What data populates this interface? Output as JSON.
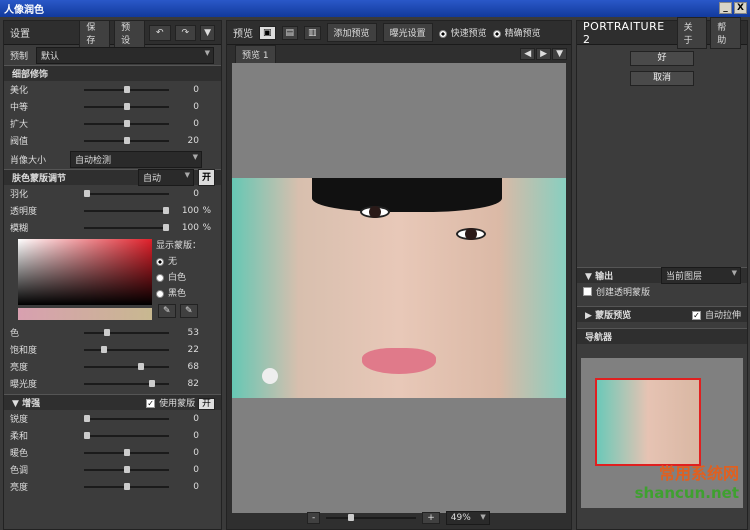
{
  "window": {
    "title": "人像润色",
    "min": "_",
    "close": "X"
  },
  "left": {
    "header": {
      "title": "设置",
      "save": "保存",
      "preset": "预设"
    },
    "preset": {
      "label": "预制",
      "value": "默认"
    },
    "detail": {
      "title": "细部修饰",
      "rows": [
        {
          "label": "美化",
          "value": "0",
          "level": 0.5
        },
        {
          "label": "中等",
          "value": "0",
          "level": 0.5
        },
        {
          "label": "扩大",
          "value": "0",
          "level": 0.5
        },
        {
          "label": "阀值",
          "value": "20",
          "level": 0.5
        }
      ],
      "size_label": "肖像大小",
      "size_value": "自动检测"
    },
    "mask": {
      "title": "肤色蒙版调节",
      "mode": "自动",
      "on": "开",
      "rows": [
        {
          "label": "羽化",
          "value": "0",
          "unit": "",
          "level": 0.0
        },
        {
          "label": "透明度",
          "value": "100",
          "unit": "%",
          "level": 1.0
        },
        {
          "label": "模糊",
          "value": "100",
          "unit": "%",
          "level": 1.0
        }
      ],
      "show_label": "显示蒙版：",
      "options": [
        "无",
        "白色",
        "黑色"
      ],
      "selected": "无",
      "hsl": [
        {
          "label": "色",
          "value": "53",
          "level": 0.25
        },
        {
          "label": "饱和度",
          "value": "22",
          "level": 0.22
        },
        {
          "label": "亮度",
          "value": "68",
          "level": 0.68
        },
        {
          "label": "曝光度",
          "value": "82",
          "level": 0.82
        }
      ]
    },
    "enhance": {
      "title": "增强",
      "use_mask": "使用蒙版",
      "on": "开",
      "rows": [
        {
          "label": "锐度",
          "value": "0",
          "level": 0.0
        },
        {
          "label": "柔和",
          "value": "0",
          "level": 0.0
        },
        {
          "label": "暖色",
          "value": "0",
          "level": 0.5
        },
        {
          "label": "色调",
          "value": "0",
          "level": 0.5
        },
        {
          "label": "亮度",
          "value": "0",
          "level": 0.5
        }
      ]
    }
  },
  "center": {
    "preview": "预览",
    "add_preview": "添加预览",
    "exposure": "曝光设置",
    "fast": "快速预览",
    "precise": "精确预览",
    "tab": "预览",
    "tab_num": "1",
    "zoom": "49%",
    "minus": "-",
    "plus": "+"
  },
  "right": {
    "brand": "PORTRAITURE 2",
    "about": "关于",
    "help": "帮助",
    "ok": "好",
    "cancel": "取消",
    "output": "输出",
    "output_value": "当前图层",
    "create_mask": "创建透明蒙版",
    "mask_preview": "蒙版预览",
    "auto_stretch": "自动拉伸",
    "navigator": "导航器",
    "watermark": "shancun",
    "watermark_cn": "常用系统网",
    "watermark_net": ".net"
  }
}
